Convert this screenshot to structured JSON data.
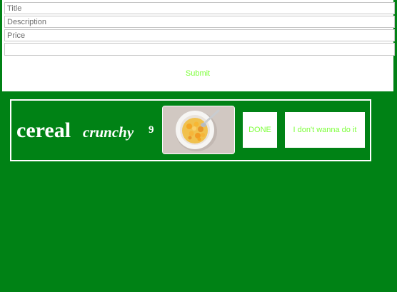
{
  "form": {
    "title_placeholder": "Title",
    "description_placeholder": "Description",
    "price_placeholder": "Price",
    "extra_placeholder": "",
    "submit_label": "Submit"
  },
  "item": {
    "title": "cereal",
    "description": "crunchy",
    "price": "9",
    "image_icon": "cereal-bowl-photo",
    "done_label": "DONE",
    "refuse_label": "I don't wanna do it"
  },
  "colors": {
    "background": "#008215",
    "button_text": "#7dff3a",
    "panel": "#ffffff"
  }
}
